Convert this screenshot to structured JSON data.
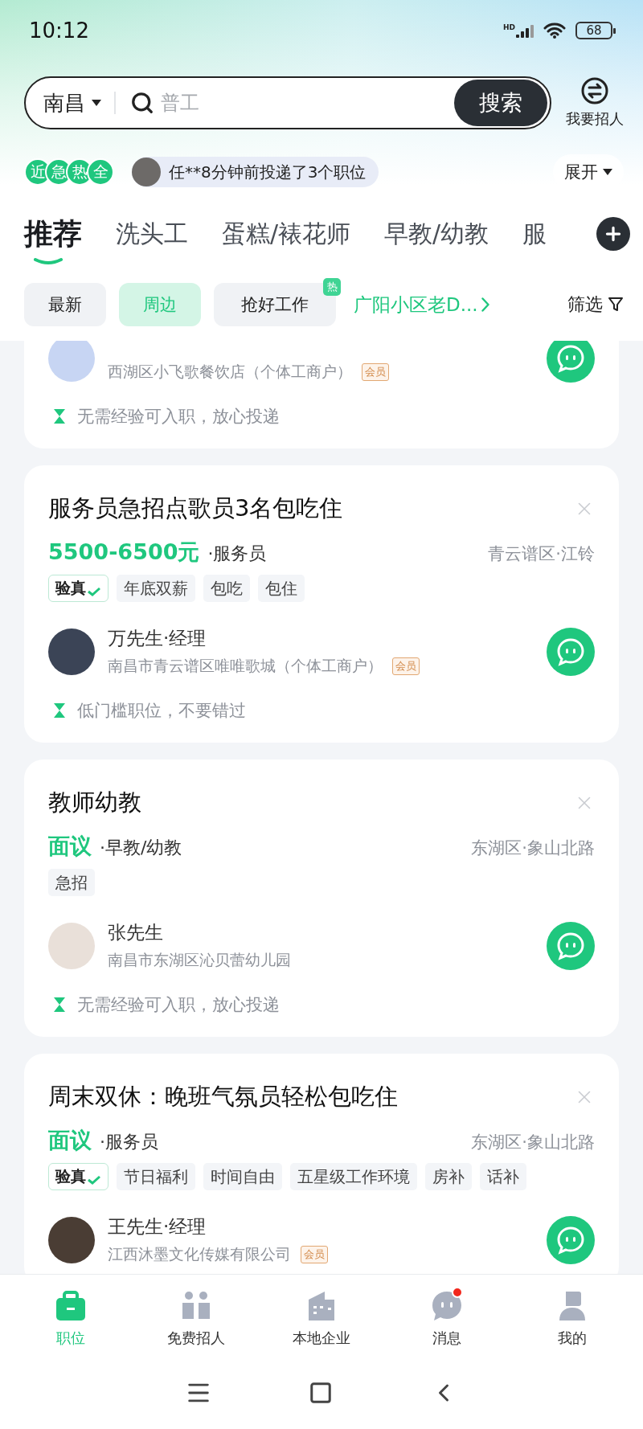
{
  "status_bar": {
    "time": "10:12",
    "network": "HD",
    "battery": "68"
  },
  "search": {
    "city": "南昌",
    "placeholder": "普工",
    "button": "搜索"
  },
  "recruit_button": "我要招人",
  "activity": {
    "badges": [
      "近",
      "急",
      "热",
      "全"
    ],
    "text": "任**8分钟前投递了3个职位",
    "expand": "展开"
  },
  "tabs": [
    {
      "label": "推荐",
      "selected": true
    },
    {
      "label": "洗头工",
      "selected": false
    },
    {
      "label": "蛋糕/裱花师",
      "selected": false
    },
    {
      "label": "早教/幼教",
      "selected": false
    },
    {
      "label": "服",
      "selected": false
    }
  ],
  "filters": [
    {
      "kind": "chip",
      "label": "最新",
      "selected": false
    },
    {
      "kind": "chip",
      "label": "周边",
      "selected": true
    },
    {
      "kind": "chip",
      "label": "抢好工作",
      "selected": false,
      "badge": "热"
    },
    {
      "kind": "location",
      "label": "广阳小区老D..."
    },
    {
      "kind": "filter",
      "label": "筛选"
    }
  ],
  "jobs": [
    {
      "company": "西湖区小飞歌餐饮店（个体工商户）",
      "member": "会员",
      "hint": "无需经验可入职，放心投递"
    },
    {
      "title": "服务员急招点歌员3名包吃住",
      "salary": "5500-6500元",
      "role": "·服务员",
      "location": "青云谱区·江铃",
      "tags": [
        {
          "kind": "verified",
          "label": "验真"
        },
        {
          "kind": "plain",
          "label": "年底双薪"
        },
        {
          "kind": "plain",
          "label": "包吃"
        },
        {
          "kind": "plain",
          "label": "包住"
        }
      ],
      "contact": "万先生·经理",
      "company": "南昌市青云谱区唯唯歌城（个体工商户）",
      "member": "会员",
      "hint": "低门槛职位，不要错过"
    },
    {
      "title": "教师幼教",
      "salary": "面议",
      "role": "·早教/幼教",
      "location": "东湖区·象山北路",
      "tags": [
        {
          "kind": "plain",
          "label": "急招"
        }
      ],
      "contact": "张先生",
      "company": "南昌市东湖区沁贝蕾幼儿园",
      "hint": "无需经验可入职，放心投递"
    },
    {
      "title": "周末双休：晚班气氛员轻松包吃住",
      "salary": "面议",
      "role": "·服务员",
      "location": "东湖区·象山北路",
      "tags": [
        {
          "kind": "verified",
          "label": "验真"
        },
        {
          "kind": "plain",
          "label": "节日福利"
        },
        {
          "kind": "plain",
          "label": "时间自由"
        },
        {
          "kind": "plain",
          "label": "五星级工作环境"
        },
        {
          "kind": "plain",
          "label": "房补"
        },
        {
          "kind": "plain",
          "label": "话补"
        }
      ],
      "contact": "王先生·经理",
      "company": "江西沐墨文化传媒有限公司",
      "member": "会员"
    }
  ],
  "bottom_nav": [
    {
      "kind": "jobs",
      "label": "职位",
      "selected": true,
      "badge": false
    },
    {
      "kind": "people",
      "label": "免费招人",
      "selected": false,
      "badge": false
    },
    {
      "kind": "company",
      "label": "本地企业",
      "selected": false,
      "badge": false
    },
    {
      "kind": "message",
      "label": "消息",
      "selected": false,
      "badge": true
    },
    {
      "kind": "me",
      "label": "我的",
      "selected": false,
      "badge": false
    }
  ]
}
